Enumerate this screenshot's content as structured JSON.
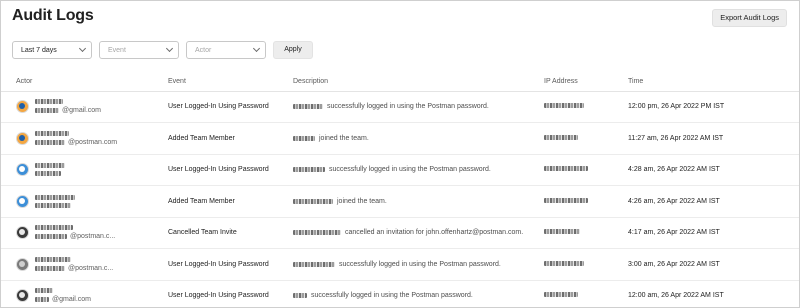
{
  "page": {
    "title": "Audit Logs"
  },
  "toolbar": {
    "export_label": "Export Audit Logs"
  },
  "filters": {
    "date_range": "Last 7 days",
    "event_placeholder": "Event",
    "actor_placeholder": "Actor",
    "apply_label": "Apply"
  },
  "table": {
    "columns": [
      "Actor",
      "Event",
      "Description",
      "IP Address",
      "Time"
    ],
    "rows": [
      {
        "avatar": "orange",
        "actor_suffix": "@gmail.com",
        "event": "User Logged-In Using Password",
        "description": "successfully logged in using the Postman password.",
        "time": "12:00 pm, 26 Apr 2022 PM IST"
      },
      {
        "avatar": "orange",
        "actor_suffix": "@postman.com",
        "event": "Added Team Member",
        "description": "joined the team.",
        "time": "11:27 am, 26 Apr 2022 AM IST"
      },
      {
        "avatar": "blue",
        "actor_suffix": "",
        "event": "User Logged-In Using Password",
        "description": "successfully logged in using the Postman password.",
        "time": "4:28 am, 26 Apr 2022 AM IST"
      },
      {
        "avatar": "blue",
        "actor_suffix": "",
        "event": "Added Team Member",
        "description": "joined the team.",
        "time": "4:26 am, 26 Apr 2022 AM IST"
      },
      {
        "avatar": "dark",
        "actor_suffix": "@postman.c...",
        "event": "Cancelled Team Invite",
        "description": "cancelled an invitation for john.offenhartz@postman.com.",
        "time": "4:17 am, 26 Apr 2022 AM IST"
      },
      {
        "avatar": "gray",
        "actor_suffix": "@postman.c...",
        "event": "User Logged-In Using Password",
        "description": "successfully logged in using the Postman password.",
        "time": "3:00 am, 26 Apr 2022 AM IST"
      },
      {
        "avatar": "dark",
        "actor_suffix": "@gmail.com",
        "event": "User Logged-In Using Password",
        "description": "successfully logged in using the Postman password.",
        "time": "12:00 am, 26 Apr 2022 AM IST"
      }
    ]
  }
}
